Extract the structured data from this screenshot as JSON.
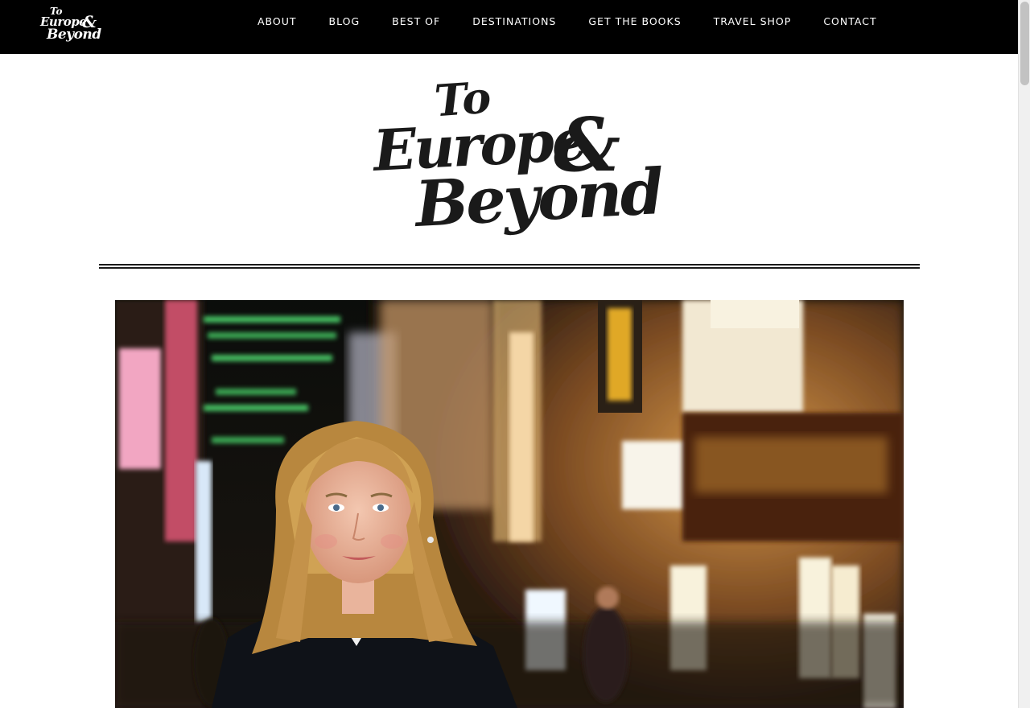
{
  "site": {
    "logo_small": {
      "line1": "To",
      "line2": "Europe",
      "amp": "&",
      "line3": "Beyond"
    },
    "logo_big": {
      "line1": "To",
      "line2": "Europe",
      "amp": "&",
      "line3": "Beyond"
    }
  },
  "nav": {
    "items": [
      {
        "label": "ABOUT"
      },
      {
        "label": "BLOG"
      },
      {
        "label": "BEST OF"
      },
      {
        "label": "DESTINATIONS"
      },
      {
        "label": "GET THE BOOKS"
      },
      {
        "label": "TRAVEL SHOP"
      },
      {
        "label": "CONTACT"
      }
    ]
  },
  "colors": {
    "nav_bg": "#000000",
    "nav_text": "#ffffff",
    "logo_ink": "#1a1a1a",
    "page_bg": "#ffffff"
  },
  "hero": {
    "image_icon": "portrait-photo"
  }
}
